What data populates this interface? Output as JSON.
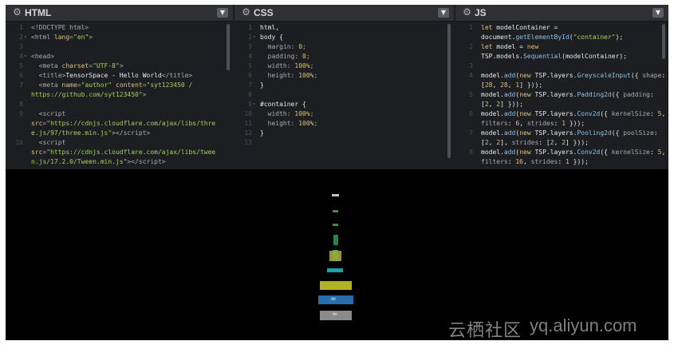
{
  "panels": [
    {
      "title": "HTML",
      "lines": [
        {
          "n": "1",
          "f": "",
          "h": "<span class=\"t\">&lt;!DOCTYPE html&gt;</span>"
        },
        {
          "n": "2",
          "f": "▾",
          "h": "<span class=\"t\">&lt;html </span><span class=\"a\">lang</span><span class=\"t\">=</span><span class=\"s\">\"en\"</span><span class=\"t\">&gt;</span>"
        },
        {
          "n": "3",
          "f": "",
          "h": ""
        },
        {
          "n": "4",
          "f": "▾",
          "h": "<span class=\"t\">&lt;head&gt;</span>"
        },
        {
          "n": "5",
          "f": "",
          "h": "  <span class=\"t\">&lt;meta </span><span class=\"a\">charset</span><span class=\"t\">=</span><span class=\"s\">\"UTF-8\"</span><span class=\"t\">&gt;</span>"
        },
        {
          "n": "6",
          "f": "",
          "h": "  <span class=\"t\">&lt;title&gt;</span><span class=\"w\">TensorSpace - Hello World</span><span class=\"t\">&lt;/title&gt;</span>"
        },
        {
          "n": "7",
          "f": "",
          "h": "  <span class=\"t\">&lt;meta </span><span class=\"a\">name</span><span class=\"t\">=</span><span class=\"s\">\"author\"</span><span class=\"t\"> </span><span class=\"a\">content</span><span class=\"t\">=</span><span class=\"s\">\"syt123450 /</span>"
        },
        {
          "n": "",
          "f": "",
          "h": "<span class=\"s\">https://github.com/syt123450\"</span><span class=\"t\">&gt;</span>"
        },
        {
          "n": "8",
          "f": "",
          "h": ""
        },
        {
          "n": "9",
          "f": "",
          "h": "  <span class=\"t\">&lt;script</span>"
        },
        {
          "n": "",
          "f": "",
          "h": "<span class=\"a\">src</span><span class=\"t\">=</span><span class=\"s\">\"https://cdnjs.cloudflare.com/ajax/libs/thre</span>"
        },
        {
          "n": "",
          "f": "",
          "h": "<span class=\"s\">e.js/97/three.min.js\"</span><span class=\"t\">&gt;&lt;/script&gt;</span>"
        },
        {
          "n": "10",
          "f": "",
          "h": "  <span class=\"t\">&lt;script</span>"
        },
        {
          "n": "",
          "f": "",
          "h": "<span class=\"a\">src</span><span class=\"t\">=</span><span class=\"s\">\"https://cdnjs.cloudflare.com/ajax/libs/twee</span>"
        },
        {
          "n": "",
          "f": "",
          "h": "<span class=\"s\">n.js/17.2.0/Tween.min.js\"</span><span class=\"t\">&gt;&lt;/script&gt;</span>"
        }
      ]
    },
    {
      "title": "CSS",
      "lines": [
        {
          "n": "1",
          "f": "",
          "h": "<span class=\"w\">html,</span>"
        },
        {
          "n": "2",
          "f": "▾",
          "h": "<span class=\"w\">body {</span>"
        },
        {
          "n": "3",
          "f": "",
          "h": "  <span class=\"t\">margin</span><span class=\"t\">: </span><span class=\"n\">0</span><span class=\"t\">;</span>"
        },
        {
          "n": "4",
          "f": "",
          "h": "  <span class=\"t\">padding</span><span class=\"t\">: </span><span class=\"n\">0</span><span class=\"t\">;</span>"
        },
        {
          "n": "5",
          "f": "",
          "h": "  <span class=\"t\">width</span><span class=\"t\">: </span><span class=\"n\">100%</span><span class=\"t\">;</span>"
        },
        {
          "n": "6",
          "f": "",
          "h": "  <span class=\"t\">height</span><span class=\"t\">: </span><span class=\"n\">100%</span><span class=\"t\">;</span>"
        },
        {
          "n": "7",
          "f": "",
          "h": "<span class=\"w\">}</span>"
        },
        {
          "n": "8",
          "f": "",
          "h": ""
        },
        {
          "n": "9",
          "f": "▾",
          "h": "<span class=\"w\">#container {</span>"
        },
        {
          "n": "10",
          "f": "",
          "h": "  <span class=\"t\">width</span><span class=\"t\">: </span><span class=\"n\">100%</span><span class=\"t\">;</span>"
        },
        {
          "n": "11",
          "f": "",
          "h": "  <span class=\"t\">height</span><span class=\"t\">: </span><span class=\"n\">100%</span><span class=\"t\">;</span>"
        },
        {
          "n": "12",
          "f": "",
          "h": "<span class=\"w\">}</span>"
        },
        {
          "n": "13",
          "f": "",
          "h": ""
        }
      ]
    },
    {
      "title": "JS",
      "lines": [
        {
          "n": "1",
          "f": "",
          "h": "<span class=\"k\">let</span><span class=\"w\"> modelContainer =</span>"
        },
        {
          "n": "",
          "f": "",
          "h": "<span class=\"w\">document.</span><span class=\"m\">getElementById</span><span class=\"w\">(</span><span class=\"s\">\"container\"</span><span class=\"w\">);</span>"
        },
        {
          "n": "2",
          "f": "",
          "h": "<span class=\"k\">let</span><span class=\"w\"> model = </span><span class=\"k\">new</span>"
        },
        {
          "n": "",
          "f": "",
          "h": "<span class=\"w\">TSP.models.</span><span class=\"m\">Sequential</span><span class=\"w\">(modelContainer);</span>"
        },
        {
          "n": "3",
          "f": "",
          "h": ""
        },
        {
          "n": "4",
          "f": "",
          "h": "<span class=\"w\">model.</span><span class=\"m\">add</span><span class=\"w\">(</span><span class=\"k\">new</span><span class=\"w\"> TSP.layers.</span><span class=\"m\">GreyscaleInput</span><span class=\"w\">({ </span><span class=\"t\">shape</span><span class=\"w\">:</span>"
        },
        {
          "n": "",
          "f": "",
          "h": "<span class=\"w\">[</span><span class=\"n\">28</span><span class=\"w\">, </span><span class=\"n\">28</span><span class=\"w\">, </span><span class=\"n\">1</span><span class=\"w\">] }));</span>"
        },
        {
          "n": "5",
          "f": "",
          "h": "<span class=\"w\">model.</span><span class=\"m\">add</span><span class=\"w\">(</span><span class=\"k\">new</span><span class=\"w\"> TSP.layers.</span><span class=\"m\">Padding2d</span><span class=\"w\">({ </span><span class=\"t\">padding</span><span class=\"w\">:</span>"
        },
        {
          "n": "",
          "f": "",
          "h": "<span class=\"w\">[</span><span class=\"n\">2</span><span class=\"w\">, </span><span class=\"n\">2</span><span class=\"w\">] }));</span>"
        },
        {
          "n": "6",
          "f": "",
          "h": "<span class=\"w\">model.</span><span class=\"m\">add</span><span class=\"w\">(</span><span class=\"k\">new</span><span class=\"w\"> TSP.layers.</span><span class=\"m\">Conv2d</span><span class=\"w\">({ </span><span class=\"t\">kernelSize</span><span class=\"w\">: </span><span class=\"n\">5</span><span class=\"w\">,</span>"
        },
        {
          "n": "",
          "f": "",
          "h": "<span class=\"t\">filters</span><span class=\"w\">: </span><span class=\"n\">6</span><span class=\"w\">, </span><span class=\"t\">strides</span><span class=\"w\">: </span><span class=\"n\">1</span><span class=\"w\"> }));</span>"
        },
        {
          "n": "7",
          "f": "",
          "h": "<span class=\"w\">model.</span><span class=\"m\">add</span><span class=\"w\">(</span><span class=\"k\">new</span><span class=\"w\"> TSP.layers.</span><span class=\"m\">Pooling2d</span><span class=\"w\">({ </span><span class=\"t\">poolSize</span><span class=\"w\">:</span>"
        },
        {
          "n": "",
          "f": "",
          "h": "<span class=\"w\">[</span><span class=\"n\">2</span><span class=\"w\">, </span><span class=\"n\">2</span><span class=\"w\">], </span><span class=\"t\">strides</span><span class=\"w\">: [</span><span class=\"n\">2</span><span class=\"w\">, </span><span class=\"n\">2</span><span class=\"w\">] }));</span>"
        },
        {
          "n": "8",
          "f": "",
          "h": "<span class=\"w\">model.</span><span class=\"m\">add</span><span class=\"w\">(</span><span class=\"k\">new</span><span class=\"w\"> TSP.layers.</span><span class=\"m\">Conv2d</span><span class=\"w\">({ </span><span class=\"t\">kernelSize</span><span class=\"w\">: </span><span class=\"n\">5</span><span class=\"w\">,</span>"
        },
        {
          "n": "",
          "f": "",
          "h": "<span class=\"t\">filters</span><span class=\"w\">: </span><span class=\"n\">16</span><span class=\"w\">, </span><span class=\"t\">strides</span><span class=\"w\">: </span><span class=\"n\">1</span><span class=\"w\"> }));</span>"
        }
      ]
    }
  ],
  "layers": [
    {
      "name": "layer-dense-output",
      "color": "#d9d9d9"
    },
    {
      "name": "layer-dense-84",
      "color": "#4a9d44"
    },
    {
      "name": "layer-dense-120",
      "color": "#4a9d44"
    },
    {
      "name": "layer-flatten",
      "color": "#2f8f5a"
    },
    {
      "name": "layer-pooling-2",
      "color": "#1fa9a9"
    },
    {
      "name": "layer-conv-16",
      "color": "#a3a832"
    },
    {
      "name": "layer-pooling-1",
      "color": "#1fb3b8"
    },
    {
      "name": "layer-conv-6",
      "color": "#c3c526"
    },
    {
      "name": "layer-padding",
      "color": "#2f79b8"
    },
    {
      "name": "layer-input",
      "color": "#9a9a9a"
    }
  ],
  "watermark": {
    "zh": "云栖社区",
    "en": "yq.aliyun.com"
  }
}
